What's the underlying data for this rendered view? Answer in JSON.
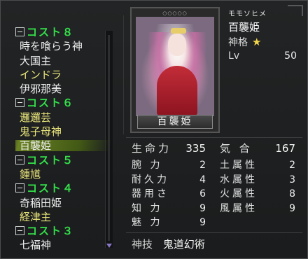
{
  "list": [
    {
      "type": "cost",
      "label": "コスト８"
    },
    {
      "type": "item",
      "label": "時を喰らう神",
      "color": "white"
    },
    {
      "type": "item",
      "label": "大国主",
      "color": "white"
    },
    {
      "type": "item",
      "label": "インドラ",
      "color": "yellow"
    },
    {
      "type": "item",
      "label": "伊邪那美",
      "color": "white"
    },
    {
      "type": "cost",
      "label": "コスト６"
    },
    {
      "type": "item",
      "label": "邏邏芸",
      "color": "yellow"
    },
    {
      "type": "item",
      "label": "鬼子母神",
      "color": "yellow"
    },
    {
      "type": "item",
      "label": "百襲姫",
      "color": "white",
      "selected": true
    },
    {
      "type": "cost",
      "label": "コスト５"
    },
    {
      "type": "item",
      "label": "鍾馗",
      "color": "yellow"
    },
    {
      "type": "cost",
      "label": "コスト４"
    },
    {
      "type": "item",
      "label": "奇稲田姫",
      "color": "white"
    },
    {
      "type": "item",
      "label": "経津主",
      "color": "yellow"
    },
    {
      "type": "cost",
      "label": "コスト３"
    },
    {
      "type": "item",
      "label": "七福神",
      "color": "white"
    }
  ],
  "card": {
    "dots": "○○○○○",
    "plate_name": "百襲姫"
  },
  "info": {
    "ruby": "モモソヒメ",
    "name": "百襲姫",
    "rank_label": "神格",
    "star": "★",
    "lv_label": "Lv",
    "lv_value": "50"
  },
  "stats": {
    "hp_label": "生命力",
    "hp_value": "335",
    "ki_label": "気 合",
    "ki_value": "167",
    "left": [
      {
        "label": "腕 力",
        "value": "2"
      },
      {
        "label": "耐久力",
        "value": "4"
      },
      {
        "label": "器用さ",
        "value": "6"
      },
      {
        "label": "知 力",
        "value": "9"
      },
      {
        "label": "魅 力",
        "value": "9"
      }
    ],
    "right": [
      {
        "label": "土属性",
        "value": "2"
      },
      {
        "label": "水属性",
        "value": "3"
      },
      {
        "label": "火属性",
        "value": "8"
      },
      {
        "label": "風属性",
        "value": "9"
      }
    ]
  },
  "skill": {
    "label": "神技",
    "value": "鬼道幻術"
  },
  "colors": {
    "cost": "#34e04a",
    "yellow_name": "#e9e57a",
    "star": "#f3d64a",
    "selection": "#6e8723"
  }
}
